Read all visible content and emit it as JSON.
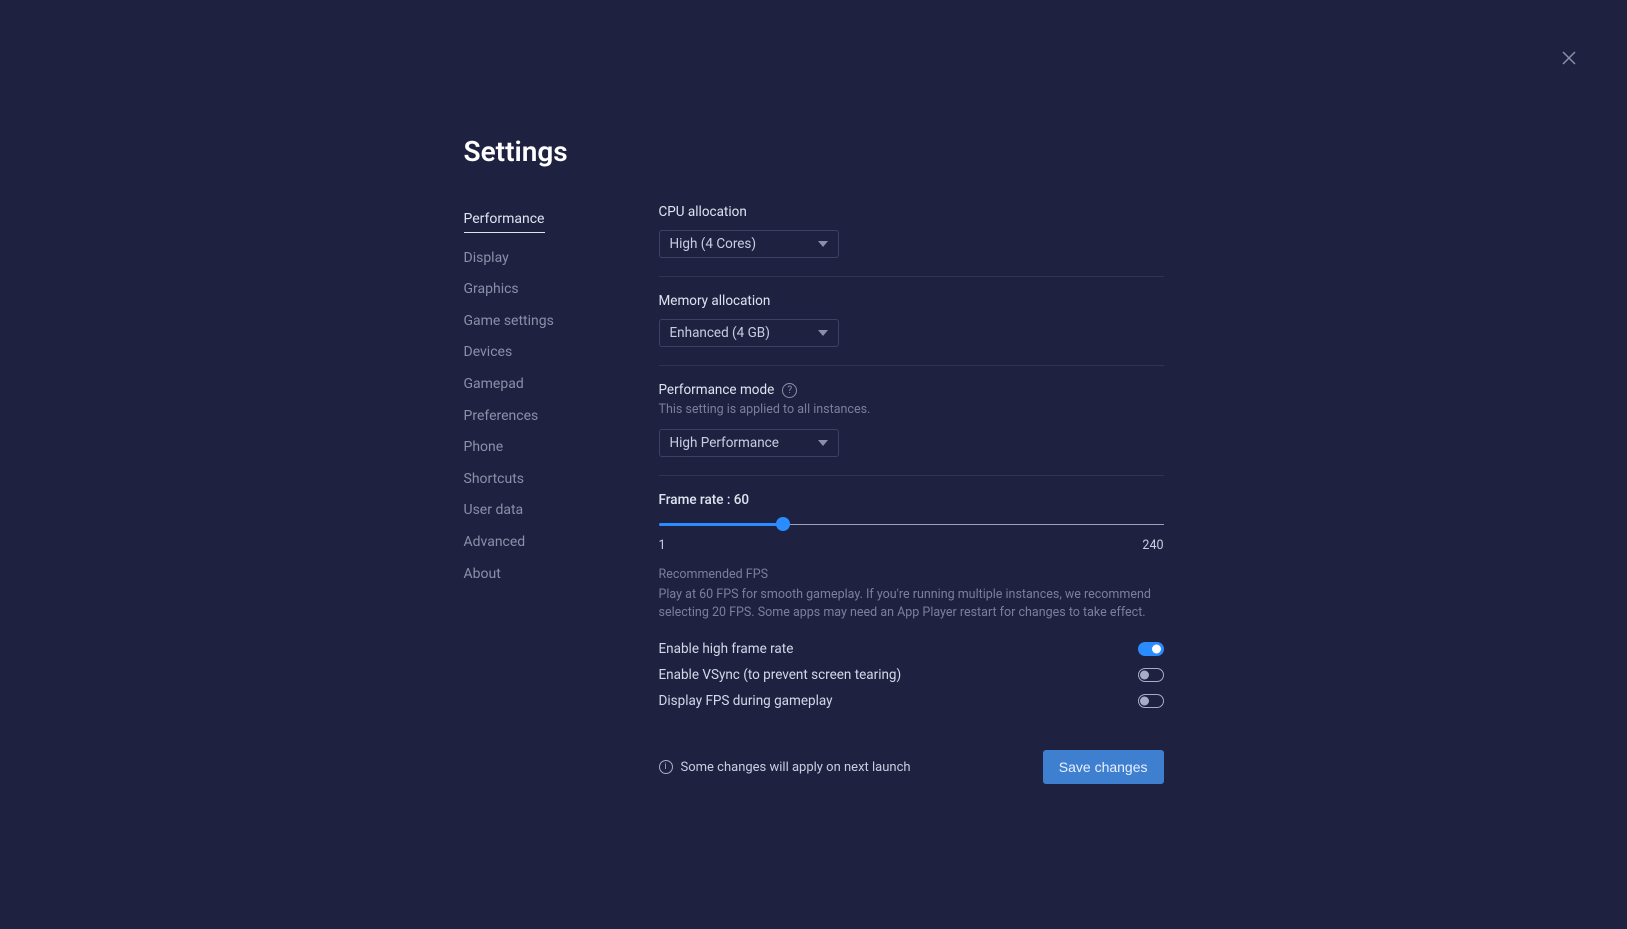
{
  "title": "Settings",
  "sidebar": {
    "items": [
      {
        "label": "Performance",
        "active": true
      },
      {
        "label": "Display"
      },
      {
        "label": "Graphics"
      },
      {
        "label": "Game settings"
      },
      {
        "label": "Devices"
      },
      {
        "label": "Gamepad"
      },
      {
        "label": "Preferences"
      },
      {
        "label": "Phone"
      },
      {
        "label": "Shortcuts"
      },
      {
        "label": "User data"
      },
      {
        "label": "Advanced"
      },
      {
        "label": "About"
      }
    ]
  },
  "cpu": {
    "label": "CPU allocation",
    "value": "High (4 Cores)"
  },
  "memory": {
    "label": "Memory allocation",
    "value": "Enhanced (4 GB)"
  },
  "perfmode": {
    "label": "Performance mode",
    "sub": "This setting is applied to all instances.",
    "value": "High Performance"
  },
  "fps": {
    "label_prefix": "Frame rate : ",
    "value": 60,
    "min": 1,
    "max": 240,
    "min_label": "1",
    "max_label": "240",
    "rec_title": "Recommended FPS",
    "rec_body": "Play at 60 FPS for smooth gameplay. If you're running multiple instances, we recommend selecting 20 FPS. Some apps may need an App Player restart for changes to take effect."
  },
  "toggles": [
    {
      "label": "Enable high frame rate",
      "on": true
    },
    {
      "label": "Enable VSync (to prevent screen tearing)",
      "on": false
    },
    {
      "label": "Display FPS during gameplay",
      "on": false
    }
  ],
  "notice": "Some changes will apply on next launch",
  "save_label": "Save changes"
}
